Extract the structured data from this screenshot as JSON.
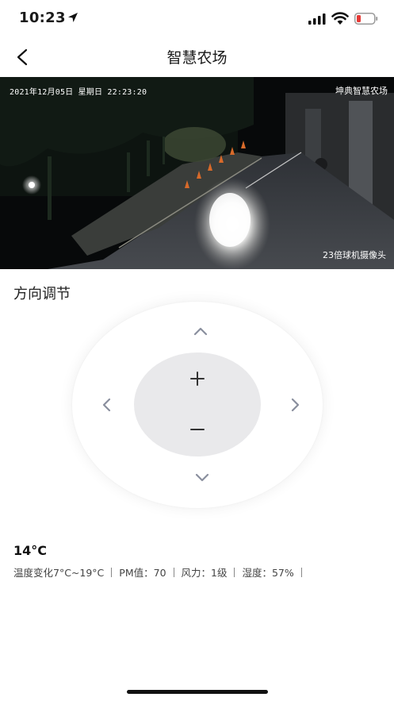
{
  "status_bar": {
    "time": "10:23",
    "icons": [
      "location-arrow-icon",
      "signal-icon",
      "wifi-icon",
      "battery-low-icon"
    ],
    "battery_color": "#e53935"
  },
  "nav": {
    "title": "智慧农场",
    "back_icon": "chevron-left-icon"
  },
  "camera": {
    "timestamp": "2021年12月05日 星期日 22:23:20",
    "brand": "坤典智慧农场",
    "label": "23倍球机摄像头"
  },
  "control": {
    "section_title": "方向调节",
    "buttons": {
      "up": "chevron-up-icon",
      "down": "chevron-down-icon",
      "left": "chevron-left-icon",
      "right": "chevron-right-icon",
      "zoom_in": "+",
      "zoom_out": "−"
    },
    "pad_color": "#e9e9eb",
    "arrow_color": "#8a8f9e"
  },
  "weather": {
    "temperature": "14°C",
    "range": "温度变化7°C~19°C",
    "pm": "PM值：70",
    "wind": "风力：1级",
    "humidity": "湿度：57%"
  }
}
